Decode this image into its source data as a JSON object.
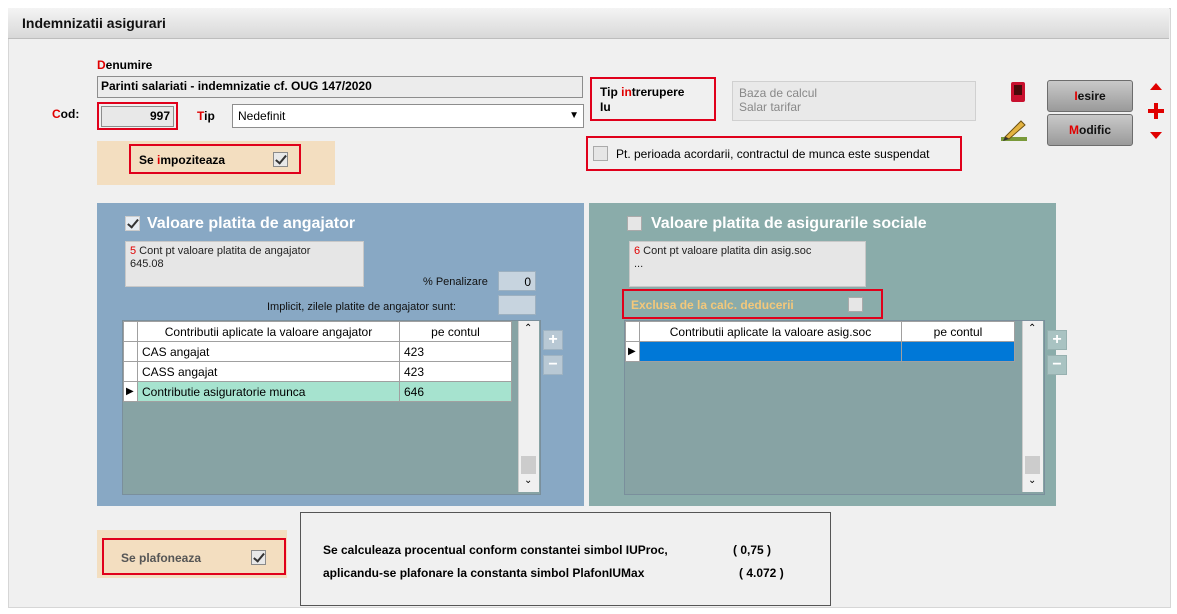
{
  "window": {
    "title": "Indemnizatii asigurari"
  },
  "denumire": {
    "label_first": "D",
    "label_rest": "enumire",
    "value": "Parinti salariati - indemnizatie cf. OUG 147/2020"
  },
  "cod": {
    "label_first": "C",
    "label_rest": "od:",
    "value": "997"
  },
  "tip": {
    "label_first": "T",
    "label_rest": "ip",
    "value": "Nedefinit"
  },
  "tip_intrerupere": {
    "line1_a": "Tip ",
    "line1_red": "in",
    "line1_b": "trerupere",
    "line2": "Iu"
  },
  "baza_calcul": {
    "line1": "Baza de calcul",
    "line2": "Salar tarifar"
  },
  "se_impoziteaza": {
    "label_a": "Se ",
    "label_red": "i",
    "label_b": "mpoziteaza",
    "checked": true
  },
  "suspendat": {
    "label": "Pt. perioada acordarii, contractul de munca este suspendat",
    "checked": false
  },
  "buttons": {
    "iesire_first": "I",
    "iesire_rest": "esire",
    "modific_first": "M",
    "modific_rest": "odific"
  },
  "angajator": {
    "title": "Valoare platita de angajator",
    "checked": true,
    "cont_num": "5",
    "cont_label": " Cont pt valoare platita de angajator",
    "cont_value": "645.08",
    "penalizare_label": "% Penalizare",
    "penalizare_value": "0",
    "implicit_label": "Implicit, zilele platite de angajator sunt:",
    "grid": {
      "col1": "Contributii aplicate la valoare angajator",
      "col2": "pe contul",
      "rows": [
        {
          "name": "CAS angajat",
          "cont": "423"
        },
        {
          "name": "CASS angajat",
          "cont": "423"
        },
        {
          "name": "Contributie asiguratorie munca",
          "cont": "646"
        }
      ]
    }
  },
  "asig_soc": {
    "title": "Valoare platita de asigurarile sociale",
    "checked": false,
    "cont_num": "6",
    "cont_label": " Cont pt valoare platita din asig.soc",
    "cont_value": "...",
    "exclusa_label": "Exclusa de la calc. deducerii",
    "grid": {
      "col1": "Contributii aplicate la valoare asig.soc",
      "col2": "pe contul"
    }
  },
  "plafoneaza": {
    "label": "Se plafoneaza",
    "checked": true
  },
  "info": {
    "line1": "Se calculeaza procentual conform constantei simbol IUProc,",
    "val1": "( 0,75 )",
    "line2": "aplicandu-se plafonare la  constanta simbol PlafonIUMax",
    "val2": "( 4.072 )"
  },
  "colors": {
    "accent_red": "#e00000",
    "grid_selected": "#a6e3cf",
    "row_blue": "#0078d7",
    "exclusa_text": "#f4c87a"
  }
}
